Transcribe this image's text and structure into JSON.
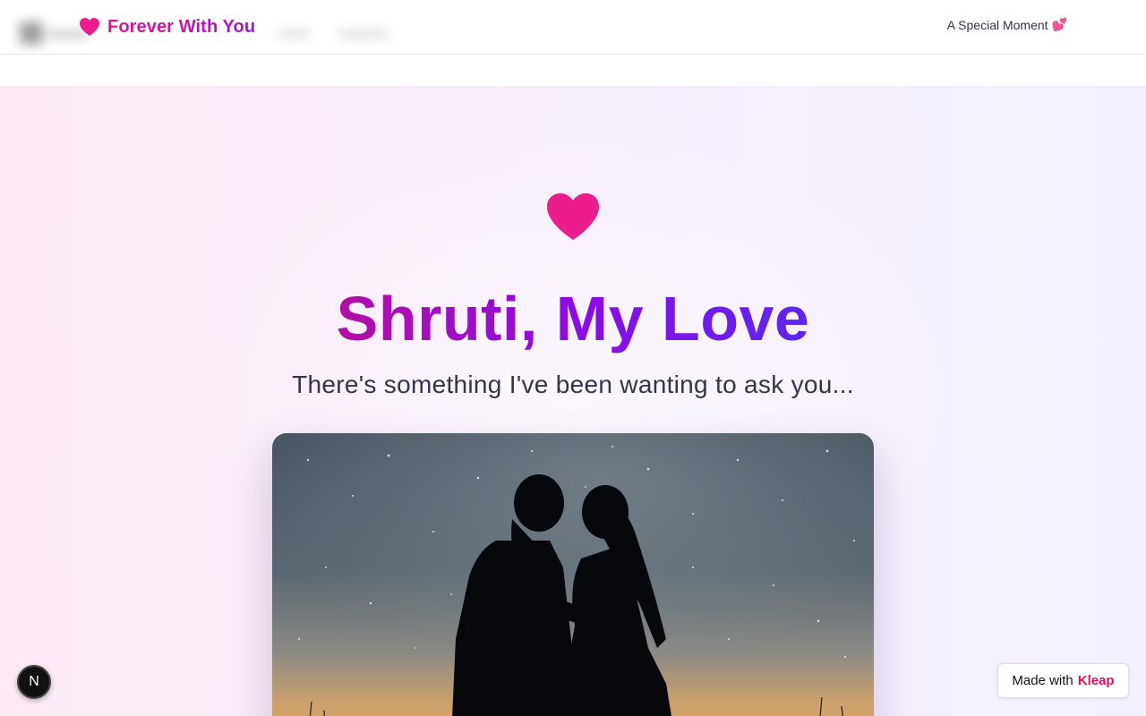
{
  "header": {
    "brand_name": "Forever With You",
    "brand_icon": "heart-icon",
    "moment_label": "A Special Moment",
    "moment_icon": "💕"
  },
  "hero": {
    "heart_icon": "heart-icon",
    "title": "Shruti, My Love",
    "subtitle": "There's something I've been wanting to ask you...",
    "photo_alt": "couple-silhouette-under-milky-way"
  },
  "badges": {
    "n_badge_label": "N",
    "made_with_label": "Made with",
    "made_with_brand": "Kleap"
  },
  "colors": {
    "accent_pink": "#ec1c8c",
    "title_gradient_start": "#b30fa6",
    "title_gradient_end": "#5b26f2",
    "kleap_brand": "#e0115f"
  }
}
